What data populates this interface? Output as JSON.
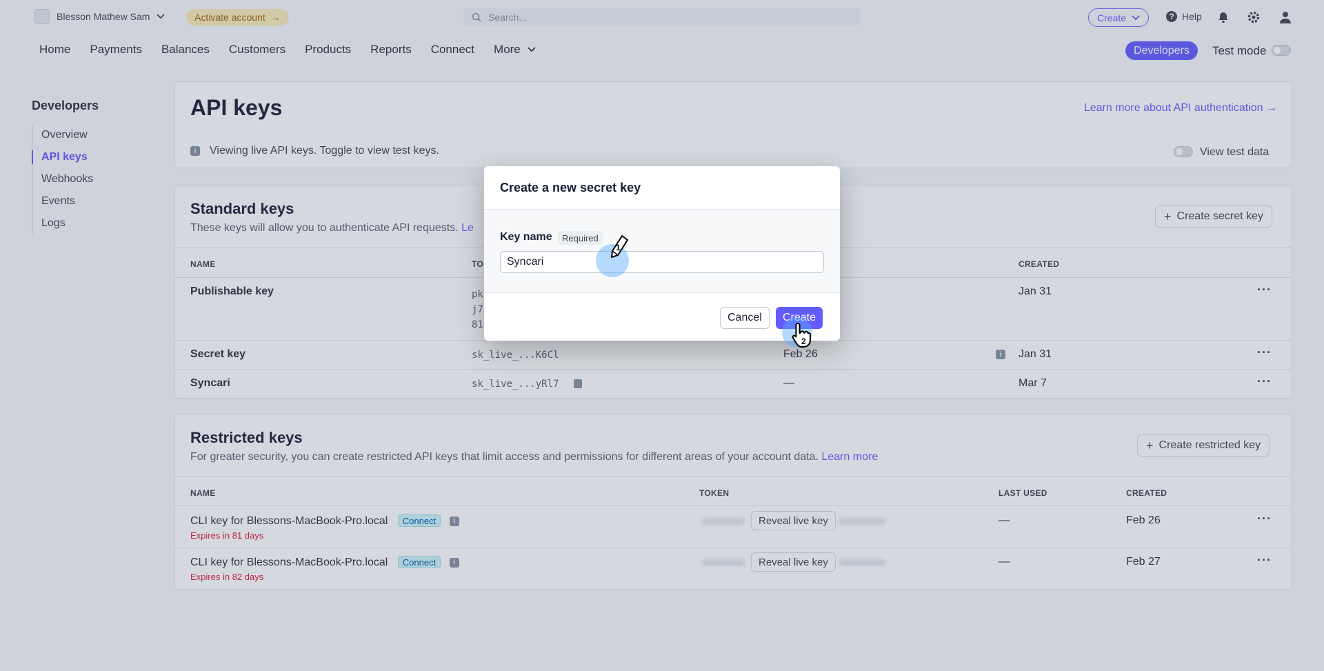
{
  "topbar": {
    "account_name": "Blesson Mathew Sam",
    "activate_label": "Activate account",
    "search_placeholder": "Search...",
    "create_label": "Create",
    "help_label": "Help"
  },
  "nav": {
    "items": [
      "Home",
      "Payments",
      "Balances",
      "Customers",
      "Products",
      "Reports",
      "Connect",
      "More"
    ],
    "developers_label": "Developers",
    "test_mode_label": "Test mode"
  },
  "sidebar": {
    "title": "Developers",
    "items": [
      {
        "label": "Overview",
        "active": false
      },
      {
        "label": "API keys",
        "active": true
      },
      {
        "label": "Webhooks",
        "active": false
      },
      {
        "label": "Events",
        "active": false
      },
      {
        "label": "Logs",
        "active": false
      }
    ]
  },
  "page": {
    "title": "API keys",
    "learn_link": "Learn more about API authentication →",
    "live_note": "Viewing live API keys. Toggle to view test keys.",
    "view_test_label": "View test data"
  },
  "standard": {
    "title": "Standard keys",
    "subtitle": "These keys will allow you to authenticate API requests.",
    "subtitle_link": "Le",
    "create_button": "Create secret key",
    "headers": {
      "name": "NAME",
      "token": "TO",
      "created": "CREATED"
    },
    "rows": [
      {
        "name": "Publishable key",
        "token_lines": [
          "pk",
          "j7",
          "81"
        ],
        "last_used": "",
        "created": "Jan 31"
      },
      {
        "name": "Secret key",
        "token": "sk_live_...K6Cl",
        "last_used": "Feb 26",
        "created": "Jan 31"
      },
      {
        "name": "Syncari",
        "token": "sk_live_...yRl7",
        "last_used": "—",
        "created": "Mar 7"
      }
    ]
  },
  "restricted": {
    "title": "Restricted keys",
    "subtitle": "For greater security, you can create restricted API keys that limit access and permissions for different areas of your account data.",
    "subtitle_link": "Learn more",
    "create_button": "Create restricted key",
    "headers": {
      "name": "NAME",
      "token": "TOKEN",
      "last_used": "LAST USED",
      "created": "CREATED"
    },
    "rows": [
      {
        "name": "CLI key for Blessons-MacBook-Pro.local",
        "badge": "Connect",
        "expires": "Expires in 81 days",
        "reveal": "Reveal live key",
        "last_used": "—",
        "created": "Feb 26"
      },
      {
        "name": "CLI key for Blessons-MacBook-Pro.local",
        "badge": "Connect",
        "expires": "Expires in 82 days",
        "reveal": "Reveal live key",
        "last_used": "—",
        "created": "Feb 27"
      }
    ]
  },
  "modal": {
    "title": "Create a new secret key",
    "field_label": "Key name",
    "required_label": "Required",
    "field_value": "Syncari",
    "cancel_label": "Cancel",
    "create_label": "Create"
  },
  "annotations": {
    "step1": "1",
    "step2": "2"
  },
  "colors": {
    "accent": "#635bff",
    "overlay": "#3f4e68"
  }
}
